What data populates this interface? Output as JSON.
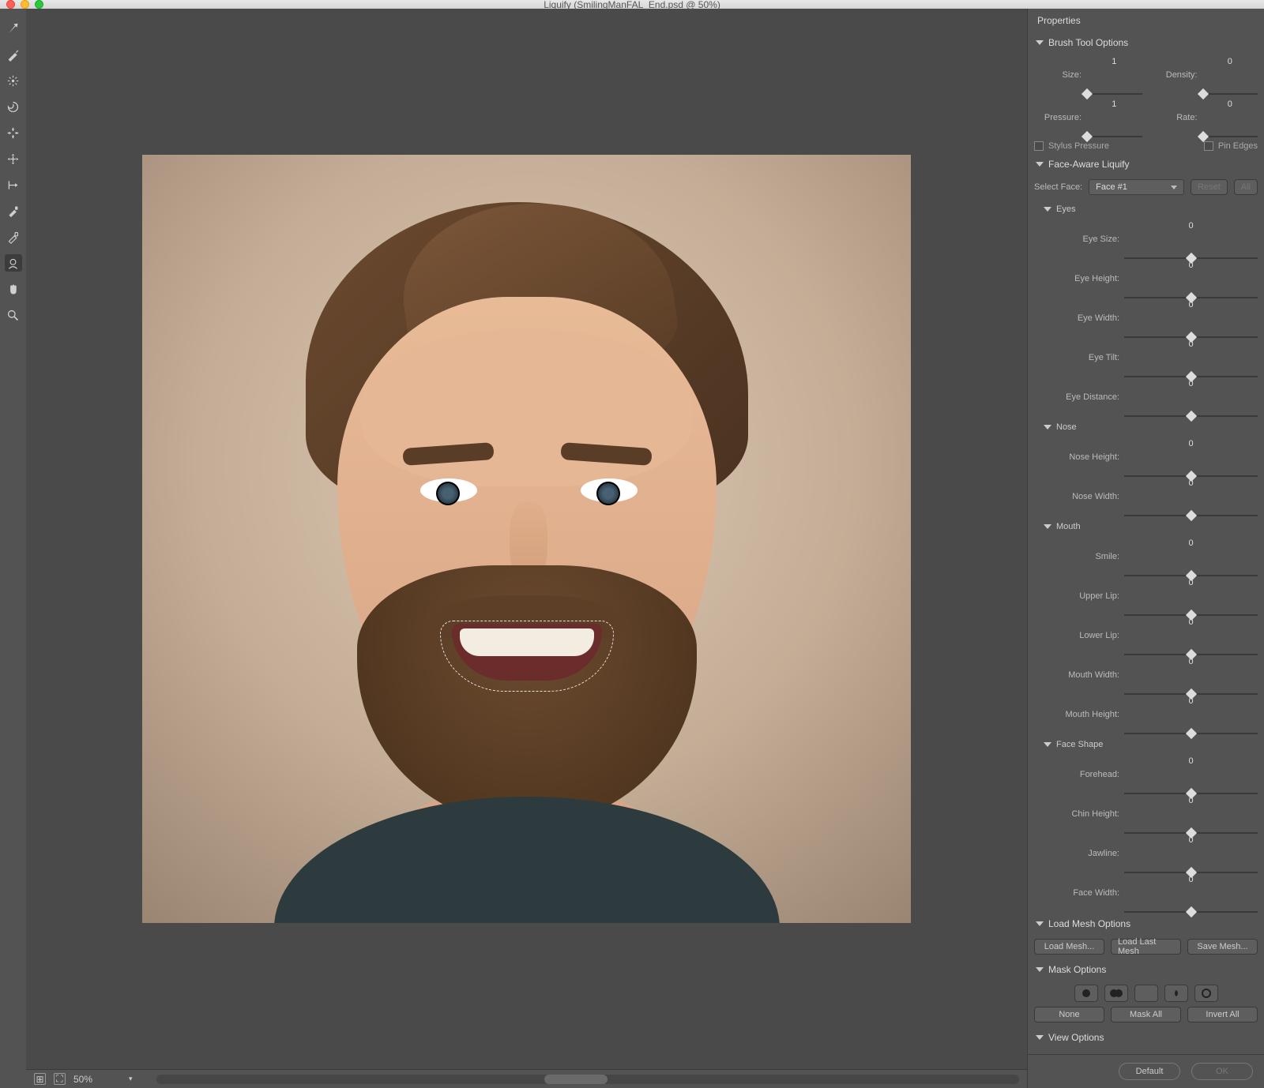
{
  "titlebar": {
    "title": "Liquify (SmilingManFAL_End.psd @ 50%)"
  },
  "statusbar": {
    "zoom": "50%"
  },
  "tools": [
    {
      "name": "forward-warp",
      "selected": false
    },
    {
      "name": "reconstruct",
      "selected": false
    },
    {
      "name": "smooth",
      "selected": false
    },
    {
      "name": "twirl",
      "selected": false
    },
    {
      "name": "pucker",
      "selected": false
    },
    {
      "name": "bloat",
      "selected": false
    },
    {
      "name": "push-left",
      "selected": false
    },
    {
      "name": "freeze-mask",
      "selected": false
    },
    {
      "name": "thaw-mask",
      "selected": false
    },
    {
      "name": "face",
      "selected": true
    },
    {
      "name": "hand",
      "selected": false
    },
    {
      "name": "zoom",
      "selected": false
    }
  ],
  "panel": {
    "title": "Properties",
    "brush": {
      "header": "Brush Tool Options",
      "size": {
        "label": "Size:",
        "value": "1"
      },
      "density": {
        "label": "Density:",
        "value": "0"
      },
      "pressure": {
        "label": "Pressure:",
        "value": "1"
      },
      "rate": {
        "label": "Rate:",
        "value": "0"
      },
      "stylus_label": "Stylus Pressure",
      "pin_label": "Pin Edges"
    },
    "face": {
      "header": "Face-Aware Liquify",
      "select_label": "Select Face:",
      "select_value": "Face #1",
      "reset": "Reset",
      "all": "All",
      "eyes": {
        "header": "Eyes",
        "size": {
          "label": "Eye Size:",
          "value": "0"
        },
        "height": {
          "label": "Eye Height:",
          "value": "0"
        },
        "width": {
          "label": "Eye Width:",
          "value": "0"
        },
        "tilt": {
          "label": "Eye Tilt:",
          "value": "0"
        },
        "distance": {
          "label": "Eye Distance:",
          "value": "0"
        }
      },
      "nose": {
        "header": "Nose",
        "height": {
          "label": "Nose Height:",
          "value": "0"
        },
        "width": {
          "label": "Nose Width:",
          "value": "0"
        }
      },
      "mouth": {
        "header": "Mouth",
        "smile": {
          "label": "Smile:",
          "value": "0"
        },
        "upper": {
          "label": "Upper Lip:",
          "value": "0"
        },
        "lower": {
          "label": "Lower Lip:",
          "value": "0"
        },
        "mwidth": {
          "label": "Mouth Width:",
          "value": "0"
        },
        "mheight": {
          "label": "Mouth Height:",
          "value": "0"
        }
      },
      "shape": {
        "header": "Face Shape",
        "forehead": {
          "label": "Forehead:",
          "value": "0"
        },
        "chin": {
          "label": "Chin Height:",
          "value": "0"
        },
        "jaw": {
          "label": "Jawline:",
          "value": "0"
        },
        "fwidth": {
          "label": "Face Width:",
          "value": "0"
        }
      }
    },
    "mesh": {
      "header": "Load Mesh Options",
      "load": "Load Mesh...",
      "last": "Load Last Mesh",
      "save": "Save Mesh..."
    },
    "mask": {
      "header": "Mask Options",
      "none": "None",
      "mask_all": "Mask All",
      "invert": "Invert All"
    },
    "view": {
      "header": "View Options"
    }
  },
  "footer": {
    "default": "Default",
    "ok": "OK"
  }
}
